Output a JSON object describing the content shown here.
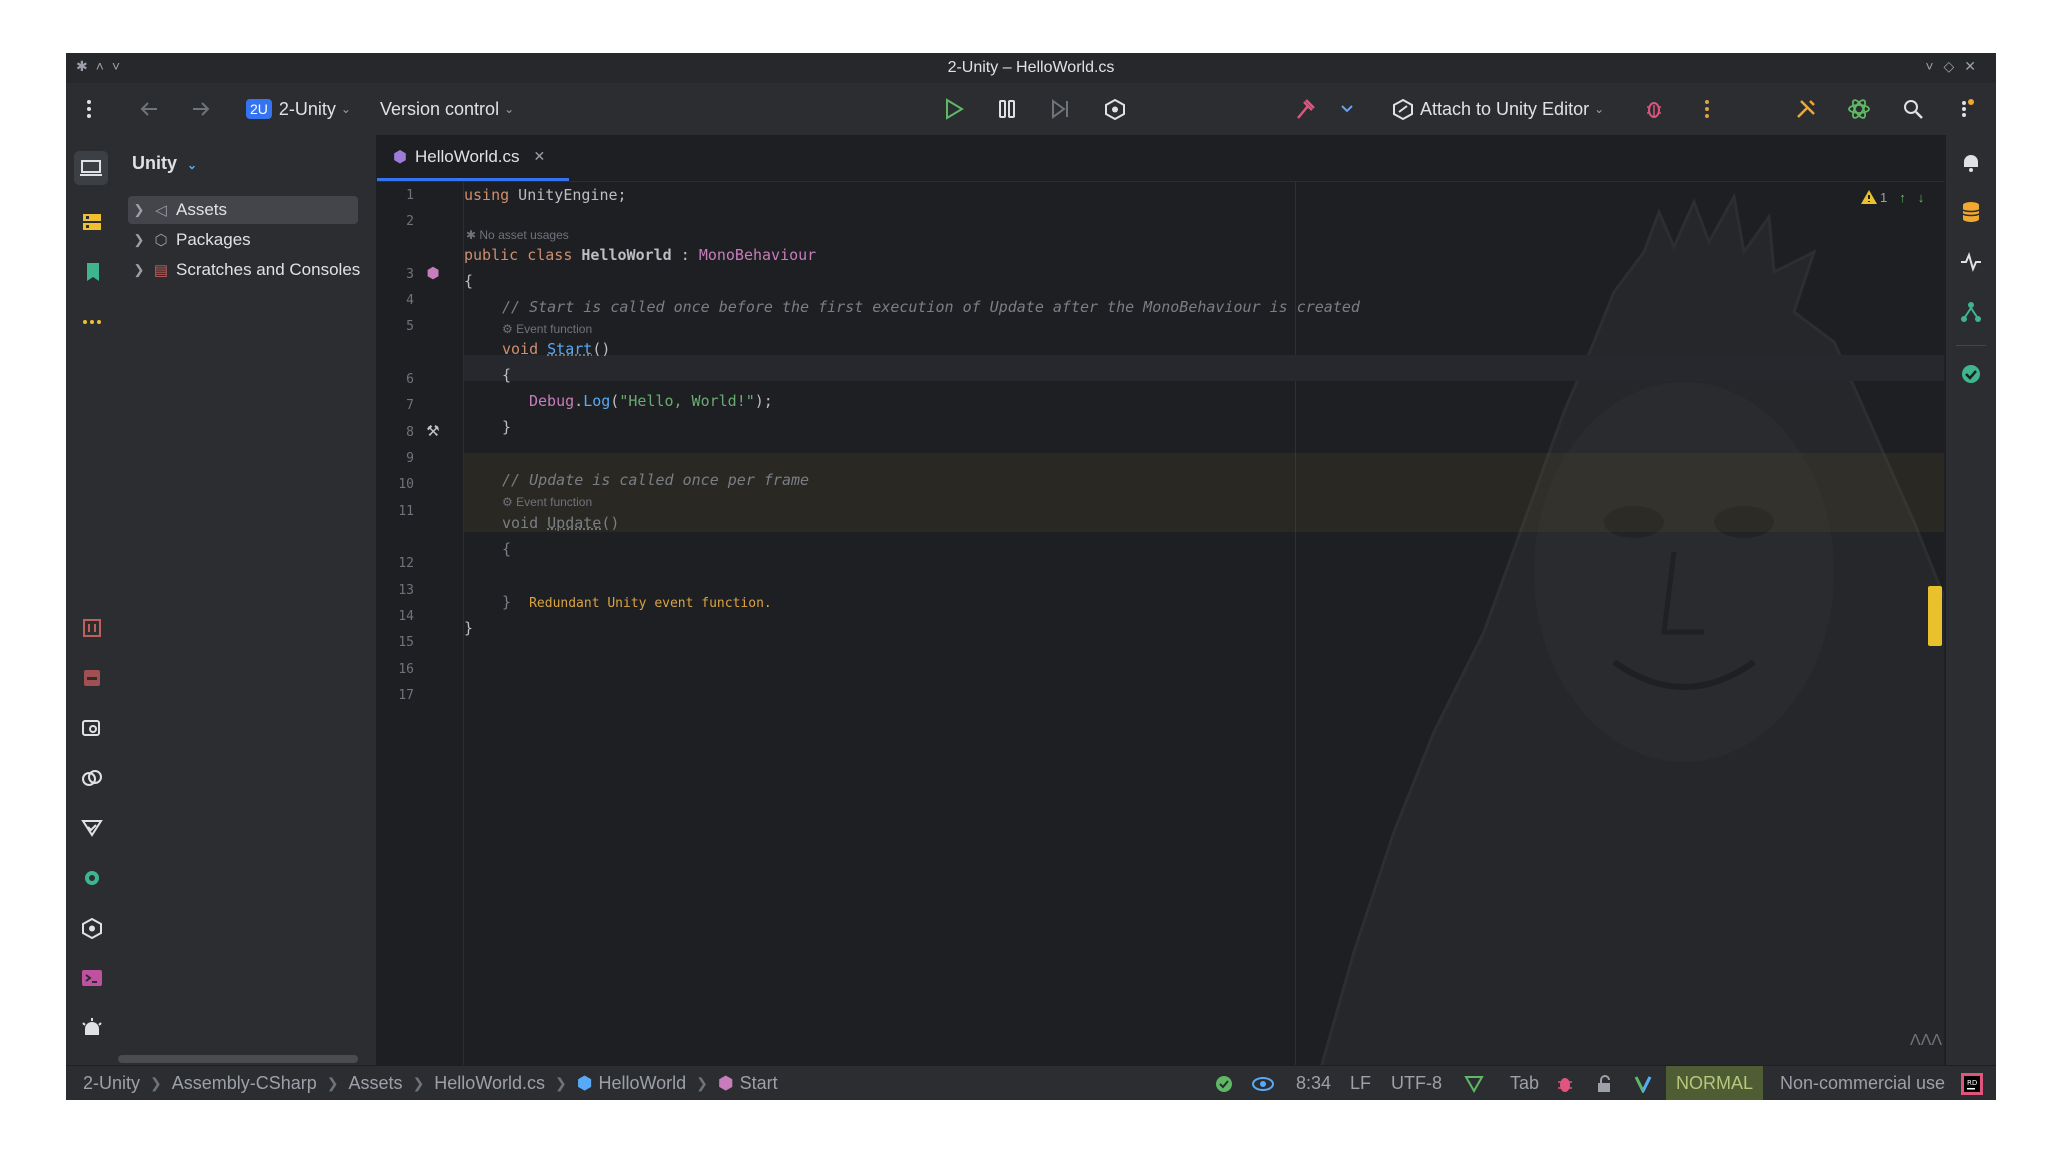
{
  "window": {
    "title": "2-Unity – HelloWorld.cs"
  },
  "toolbar": {
    "project_badge": "2U",
    "project_name": "2-Unity",
    "version_control": "Version control",
    "attach_label": "Attach to Unity Editor"
  },
  "project_panel": {
    "title": "Unity",
    "items": [
      {
        "label": "Assets",
        "icon": "unity-assets-icon"
      },
      {
        "label": "Packages",
        "icon": "package-icon"
      },
      {
        "label": "Scratches and Consoles",
        "icon": "scratches-icon"
      }
    ]
  },
  "editor": {
    "tab": {
      "label": "HelloWorld.cs",
      "icon": "csharp-file-icon"
    },
    "warnings_count": "1",
    "line_numbers": [
      "1",
      "2",
      "3",
      "4",
      "5",
      "6",
      "7",
      "8",
      "9",
      "10",
      "11",
      "12",
      "13",
      "14",
      "15",
      "16",
      "17"
    ],
    "hints": {
      "no_usages": "No asset usages",
      "event_fn_1": "Event function",
      "event_fn_2": "Event function"
    },
    "code": {
      "l1_kw": "using",
      "l1_rest": " UnityEngine;",
      "l3_kw": "public class",
      "l3_name": "HelloWorld",
      "l3_colon": " : ",
      "l3_base": "MonoBehaviour",
      "l4": "{",
      "l5": "// Start is called once before the first execution of Update after the MonoBehaviour is created",
      "l6_kw": "void",
      "l6_name": "Start",
      "l6_rest": "()",
      "l7": "{",
      "l8_obj": "Debug",
      "l8_dot": ".",
      "l8_fn": "Log",
      "l8_open": "(",
      "l8_str": "\"Hello, World!\"",
      "l8_close": ");",
      "l9": "}",
      "l11": "// Update is called once per frame",
      "l12_kw": "void",
      "l12_name": "Update",
      "l12_rest": "()",
      "l13": "{",
      "l15_brace": "}",
      "l15_msg": "Redundant Unity event function.",
      "l16": "}"
    }
  },
  "statusbar": {
    "crumbs": [
      "2-Unity",
      "Assembly-CSharp",
      "Assets",
      "HelloWorld.cs",
      "HelloWorld",
      "Start"
    ],
    "position": "8:34",
    "line_ending": "LF",
    "encoding": "UTF-8",
    "indent": "Tab",
    "vim_mode": "NORMAL",
    "license": "Non-commercial use"
  },
  "colors": {
    "accent": "#3574f0",
    "run_green": "#5fb865",
    "warning_yellow": "#e8c12c",
    "hammer_red": "#e0557d"
  }
}
